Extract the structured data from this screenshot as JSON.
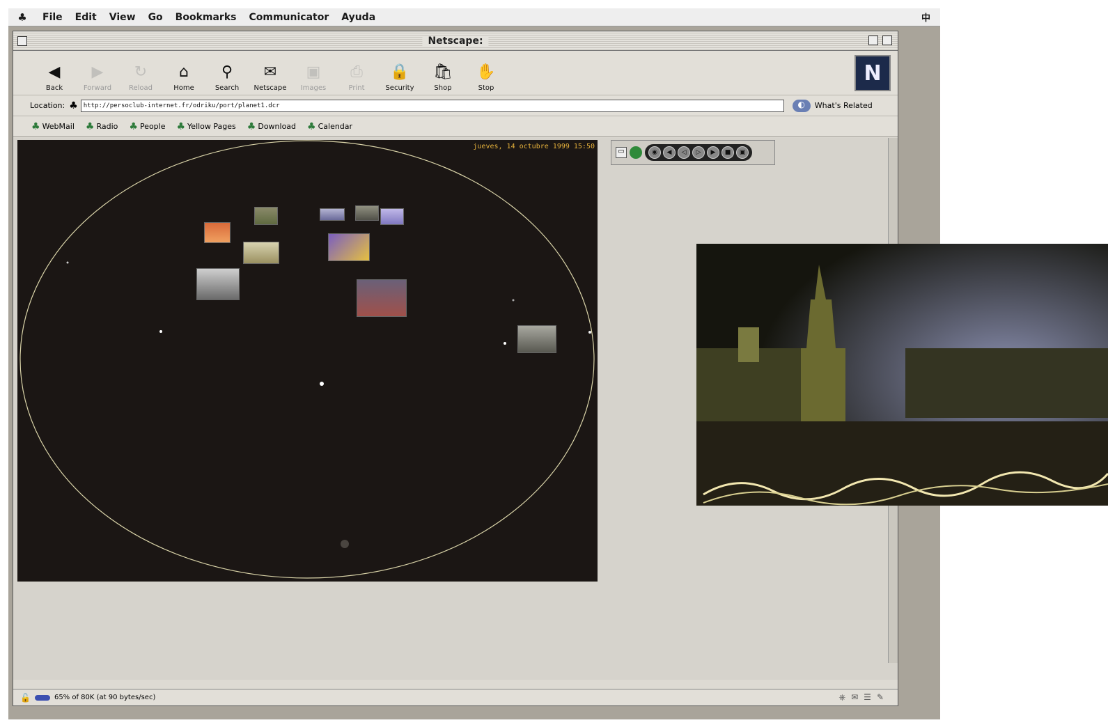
{
  "menubar": {
    "items": [
      "File",
      "Edit",
      "View",
      "Go",
      "Bookmarks",
      "Communicator",
      "Ayuda"
    ],
    "right_label": "中"
  },
  "window": {
    "title": "Netscape:"
  },
  "navbar": {
    "buttons": [
      {
        "label": "Back",
        "icon": "back-icon",
        "glyph": "◀",
        "enabled": true
      },
      {
        "label": "Forward",
        "icon": "forward-icon",
        "glyph": "▶",
        "enabled": false
      },
      {
        "label": "Reload",
        "icon": "reload-icon",
        "glyph": "↻",
        "enabled": false
      },
      {
        "label": "Home",
        "icon": "home-icon",
        "glyph": "⌂",
        "enabled": true
      },
      {
        "label": "Search",
        "icon": "search-icon",
        "glyph": "⚲",
        "enabled": true
      },
      {
        "label": "Netscape",
        "icon": "netscape-icon",
        "glyph": "✉",
        "enabled": true
      },
      {
        "label": "Images",
        "icon": "images-icon",
        "glyph": "▣",
        "enabled": false
      },
      {
        "label": "Print",
        "icon": "print-icon",
        "glyph": "⎙",
        "enabled": false
      },
      {
        "label": "Security",
        "icon": "security-icon",
        "glyph": "🔒",
        "enabled": true
      },
      {
        "label": "Shop",
        "icon": "shop-icon",
        "glyph": "🛍",
        "enabled": true
      },
      {
        "label": "Stop",
        "icon": "stop-icon",
        "glyph": "✋",
        "enabled": true
      }
    ],
    "logo_letter": "N"
  },
  "location": {
    "label": "Location:",
    "url": "http://persoclub-internet.fr/odriku/port/planet1.dcr",
    "related_label": "What's Related"
  },
  "personal_toolbar": {
    "items": [
      "WebMail",
      "Radio",
      "People",
      "Yellow Pages",
      "Download",
      "Calendar"
    ]
  },
  "applet": {
    "date_text": "jueves, 14 octubre 1999 15:50"
  },
  "player": {
    "controls": [
      "◉",
      "◀",
      "◁",
      "▷",
      "▶",
      "■",
      "▣"
    ]
  },
  "status": {
    "text": "65% of 80K (at 90 bytes/sec)"
  },
  "colors": {
    "window_bg": "#dddad3",
    "applet_bg": "#1b1614",
    "date_color": "#e7b23c",
    "orbit_color": "#d9d3a8"
  }
}
